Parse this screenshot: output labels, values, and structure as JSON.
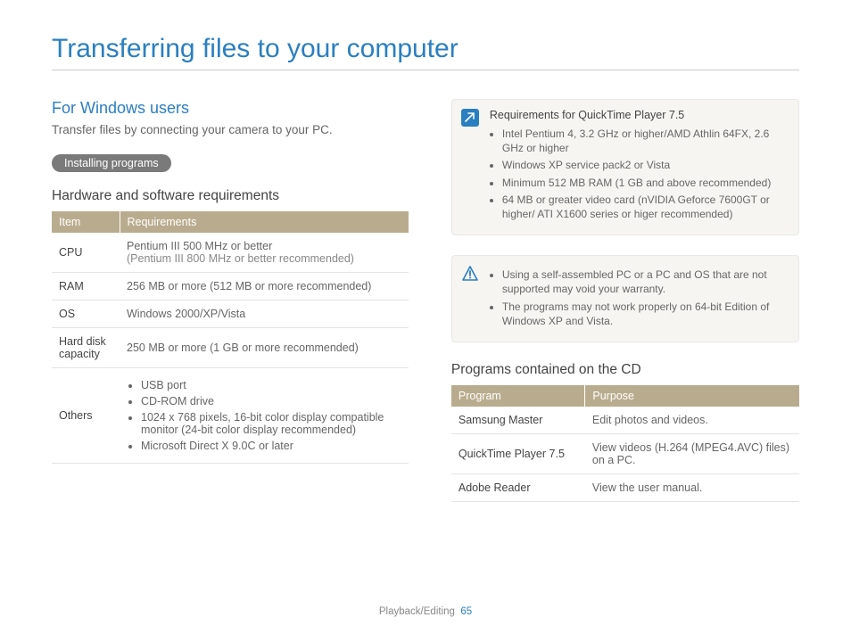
{
  "title": "Transferring files to your computer",
  "left": {
    "section": "For Windows users",
    "subtext": "Transfer files by connecting your camera to your PC.",
    "pill": "Installing programs",
    "subhead": "Hardware and software requirements",
    "th1": "Item",
    "th2": "Requirements",
    "rows": {
      "cpu_k": "CPU",
      "cpu_v": "Pentium III 500 MHz or better",
      "cpu_sub": "(Pentium III 800 MHz or better recommended)",
      "ram_k": "RAM",
      "ram_v": "256 MB or more (512 MB or more recommended)",
      "os_k": "OS",
      "os_v": "Windows 2000/XP/Vista",
      "hdd_k": "Hard disk capacity",
      "hdd_v": "250 MB or more (1 GB or more recommended)",
      "oth_k": "Others",
      "oth_1": "USB port",
      "oth_2": "CD-ROM drive",
      "oth_3": "1024 x 768 pixels, 16-bit color display compatible monitor (24-bit color display recommended)",
      "oth_4": "Microsoft Direct X 9.0C or later"
    }
  },
  "right": {
    "note1": {
      "title": "Requirements for QuickTime Player 7.5",
      "b1": "Intel Pentium 4, 3.2 GHz or higher/AMD Athlin 64FX, 2.6 GHz or higher",
      "b2": "Windows XP service pack2 or Vista",
      "b3": "Minimum 512 MB RAM (1 GB and above recommended)",
      "b4": "64 MB or greater video card (nVIDIA Geforce 7600GT or higher/ ATI X1600 series or higer recommended)"
    },
    "note2": {
      "b1": "Using a self-assembled PC or a PC and OS that are not supported may void your warranty.",
      "b2": "The programs may not work properly on 64-bit Edition of Windows XP and Vista."
    },
    "subhead": "Programs contained on the CD",
    "th1": "Program",
    "th2": "Purpose",
    "rows": {
      "p1_k": "Samsung Master",
      "p1_v": "Edit photos and videos.",
      "p2_k": "QuickTime Player 7.5",
      "p2_v": "View videos (H.264 (MPEG4.AVC) files) on a PC.",
      "p3_k": "Adobe Reader",
      "p3_v": "View the user manual."
    }
  },
  "footer": {
    "section": "Playback/Editing",
    "page": "65"
  }
}
